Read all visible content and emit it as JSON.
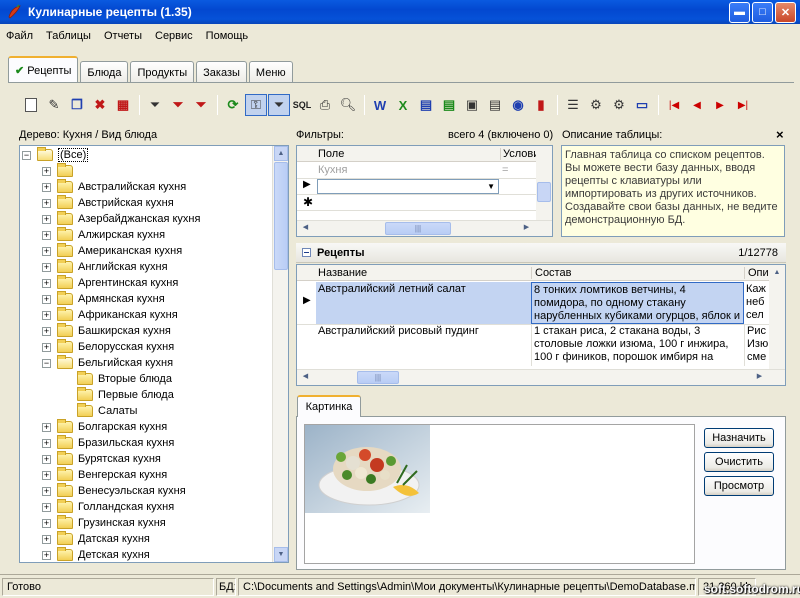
{
  "window": {
    "title": "Кулинарные рецепты (1.35)",
    "min_glyph": "▬",
    "max_glyph": "□",
    "close_glyph": "✕"
  },
  "menu": [
    "Файл",
    "Таблицы",
    "Отчеты",
    "Сервис",
    "Помощь"
  ],
  "tabs": [
    {
      "label": "Рецепты",
      "active": true
    },
    {
      "label": "Блюда"
    },
    {
      "label": "Продукты"
    },
    {
      "label": "Заказы"
    },
    {
      "label": "Меню"
    }
  ],
  "toolbar": {
    "sql_label": "SQL"
  },
  "tree": {
    "header": "Дерево: Кухня / Вид блюда",
    "root": "(Все)",
    "items": [
      {
        "label": "",
        "level": 1
      },
      {
        "label": "Австралийская кухня",
        "level": 1
      },
      {
        "label": "Австрийская кухня",
        "level": 1
      },
      {
        "label": "Азербайджанская кухня",
        "level": 1
      },
      {
        "label": "Алжирская кухня",
        "level": 1
      },
      {
        "label": "Американская кухня",
        "level": 1
      },
      {
        "label": "Английская кухня",
        "level": 1
      },
      {
        "label": "Аргентинская кухня",
        "level": 1
      },
      {
        "label": "Армянская кухня",
        "level": 1
      },
      {
        "label": "Африканская кухня",
        "level": 1
      },
      {
        "label": "Башкирская кухня",
        "level": 1
      },
      {
        "label": "Белорусская кухня",
        "level": 1
      },
      {
        "label": "Бельгийская кухня",
        "level": 1,
        "expanded": true
      },
      {
        "label": "Вторые блюда",
        "level": 2
      },
      {
        "label": "Первые блюда",
        "level": 2
      },
      {
        "label": "Салаты",
        "level": 2
      },
      {
        "label": "Болгарская кухня",
        "level": 1
      },
      {
        "label": "Бразильская кухня",
        "level": 1
      },
      {
        "label": "Бурятская кухня",
        "level": 1
      },
      {
        "label": "Венгерская кухня",
        "level": 1
      },
      {
        "label": "Венесуэльская кухня",
        "level": 1
      },
      {
        "label": "Голландская кухня",
        "level": 1
      },
      {
        "label": "Грузинская кухня",
        "level": 1
      },
      {
        "label": "Датская кухня",
        "level": 1
      },
      {
        "label": "Детская кухня",
        "level": 1
      }
    ]
  },
  "filters": {
    "header": "Фильтры:",
    "summary": "всего 4 (включено 0)",
    "col_field": "Поле",
    "col_condition": "Услови",
    "placeholder_field": "Кухня",
    "placeholder_op": "="
  },
  "description": {
    "header": "Описание таблицы:",
    "close_glyph": "×",
    "text": "Главная таблица со списком рецептов. Вы можете вести базу данных, вводя рецепты с клавиатуры или импортировать из других источников. Создавайте свои базы данных, не ведите демонстрационную БД."
  },
  "recipes": {
    "title": "Рецепты",
    "count": "1/12778",
    "columns": [
      "Название",
      "Состав",
      "Опи"
    ],
    "rows": [
      {
        "name": "Австралийский летний салат",
        "composition": "8 тонких ломтиков ветчины, 4 помидора, по одному стакану нарубленных кубиками огурцов, яблок и сельдерея, 2",
        "desc": "Каж\nнеб\nсел"
      },
      {
        "name": "Австралийский рисовый пудинг",
        "composition": "1 стакан риса, 2 стакана воды, 3 столовые ложки изюма, 100 г инжира, 100 г фиников, порошок имбиря на",
        "desc": "Рис\nИзю\nсме"
      }
    ]
  },
  "image_panel": {
    "tab": "Картинка",
    "buttons": [
      "Назначить",
      "Очистить",
      "Просмотр"
    ]
  },
  "status": {
    "ready": "Готово",
    "db_label": "БД:",
    "db_path": "C:\\Documents and Settings\\Admin\\Мои документы\\Кулинарные рецепты\\DemoDatabase.mdb",
    "size": "21 260 kb",
    "watermark": "soft.softodrom.ru"
  },
  "colors": {
    "titlebar": "#0a5ae0",
    "selection": "#c3d4f2",
    "description_bg": "#ffffe1"
  }
}
